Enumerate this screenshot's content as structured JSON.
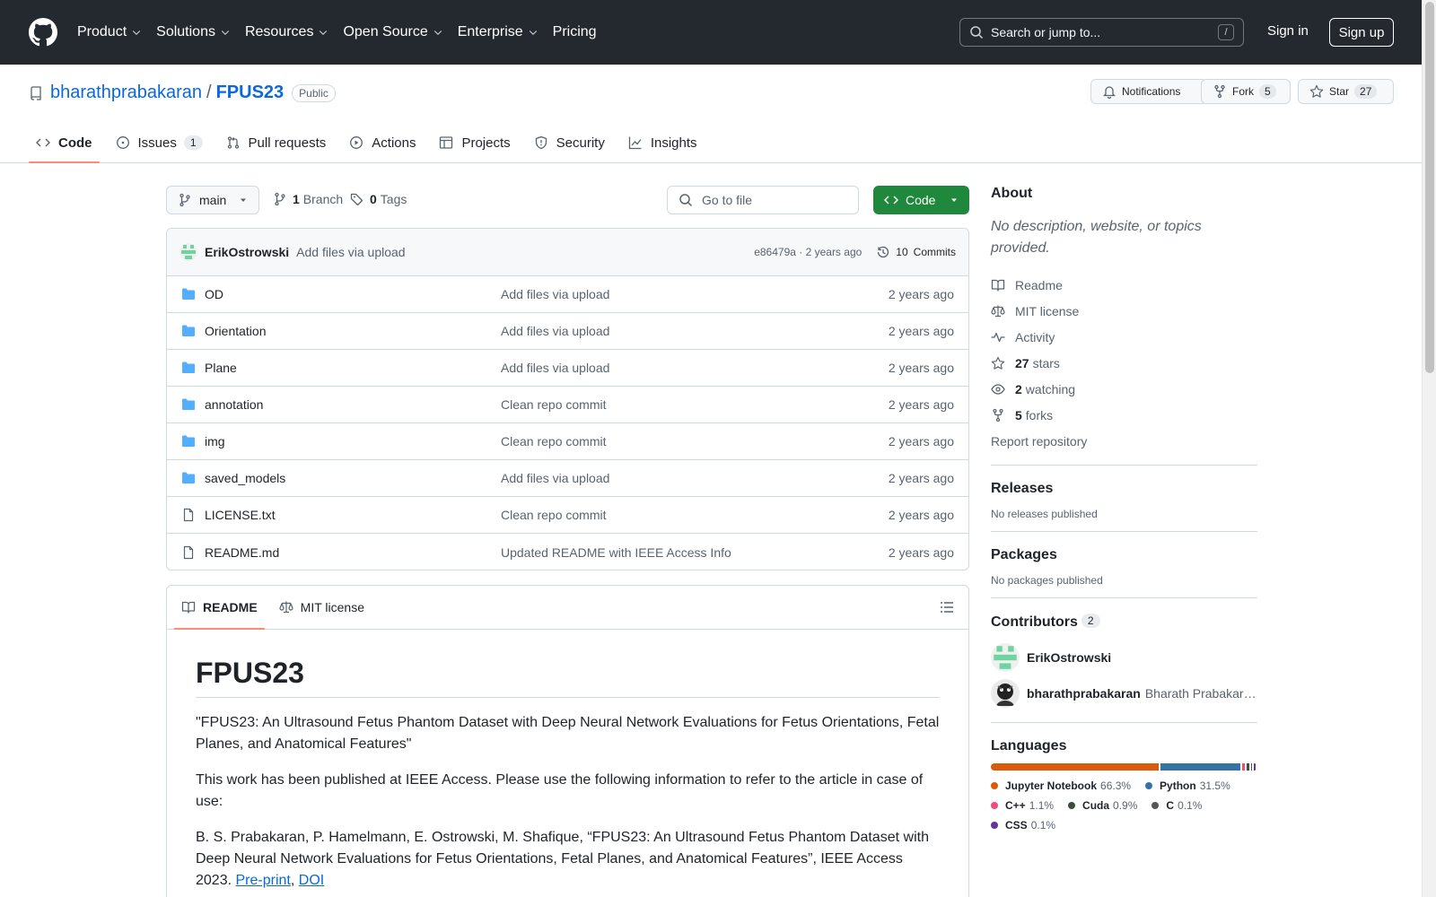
{
  "header": {
    "nav": [
      "Product",
      "Solutions",
      "Resources",
      "Open Source",
      "Enterprise",
      "Pricing"
    ],
    "search_placeholder": "Search or jump to...",
    "search_shortcut": "/",
    "sign_in": "Sign in",
    "sign_up": "Sign up"
  },
  "repo": {
    "owner": "bharathprabakaran",
    "separator": "/",
    "name": "FPUS23",
    "visibility": "Public",
    "notifications_label": "Notifications",
    "fork_label": "Fork",
    "fork_count": "5",
    "star_label": "Star",
    "star_count": "27",
    "tabs": [
      {
        "label": "Code",
        "count": ""
      },
      {
        "label": "Issues",
        "count": "1"
      },
      {
        "label": "Pull requests",
        "count": ""
      },
      {
        "label": "Actions",
        "count": ""
      },
      {
        "label": "Projects",
        "count": ""
      },
      {
        "label": "Security",
        "count": ""
      },
      {
        "label": "Insights",
        "count": ""
      }
    ]
  },
  "toolbar": {
    "branch": "main",
    "branch_count": "1",
    "branch_label": "Branch",
    "tag_count": "0",
    "tag_label": "Tags",
    "goto_placeholder": "Go to file",
    "code_label": "Code"
  },
  "commit": {
    "author": "ErikOstrowski",
    "message": "Add files via upload",
    "hash_time": "e86479a · 2 years ago",
    "commits_count": "10",
    "commits_label": "Commits"
  },
  "files": [
    {
      "name": "OD",
      "type": "folder",
      "message": "Add files via upload",
      "age": "2 years ago"
    },
    {
      "name": "Orientation",
      "type": "folder",
      "message": "Add files via upload",
      "age": "2 years ago"
    },
    {
      "name": "Plane",
      "type": "folder",
      "message": "Add files via upload",
      "age": "2 years ago"
    },
    {
      "name": "annotation",
      "type": "folder",
      "message": "Clean repo commit",
      "age": "2 years ago"
    },
    {
      "name": "img",
      "type": "folder",
      "message": "Clean repo commit",
      "age": "2 years ago"
    },
    {
      "name": "saved_models",
      "type": "folder",
      "message": "Add files via upload",
      "age": "2 years ago"
    },
    {
      "name": "LICENSE.txt",
      "type": "file",
      "message": "Clean repo commit",
      "age": "2 years ago"
    },
    {
      "name": "README.md",
      "type": "file",
      "message": "Updated README with IEEE Access Info",
      "age": "2 years ago"
    }
  ],
  "readme": {
    "tab_readme": "README",
    "tab_license": "MIT license",
    "title": "FPUS23",
    "p1": "\"FPUS23: An Ultrasound Fetus Phantom Dataset with Deep Neural Network Evaluations for Fetus Orientations, Fetal Planes, and Anatomical Features\"",
    "p2": "This work has been published at IEEE Access. Please use the following information to refer to the article in case of use:",
    "p3": "B. S. Prabakaran, P. Hamelmann, E. Ostrowski, M. Shafique, “FPUS23: An Ultrasound Fetus Phantom Dataset with Deep Neural Network Evaluations for Fetus Orientations, Fetal Planes, and Anatomical Features”, IEEE Access 2023.",
    "link_preprint": "Pre-print",
    "link_comma": ",",
    "link_doi": "DOI"
  },
  "sidebar": {
    "about_title": "About",
    "description": "No description, website, or topics provided.",
    "readme": "Readme",
    "license": "MIT license",
    "activity": "Activity",
    "stars_count": "27",
    "stars_label": "stars",
    "watching_count": "2",
    "watching_label": "watching",
    "forks_count": "5",
    "forks_label": "forks",
    "report": "Report repository",
    "releases_title": "Releases",
    "releases_empty": "No releases published",
    "packages_title": "Packages",
    "packages_empty": "No packages published",
    "contributors_title": "Contributors",
    "contributors_count": "2",
    "contributors": [
      {
        "login": "ErikOstrowski",
        "name": ""
      },
      {
        "login": "bharathprabakaran",
        "name": "Bharath Prabakaran"
      }
    ],
    "languages_title": "Languages",
    "languages": [
      {
        "name": "Jupyter Notebook",
        "percent": "66.3%",
        "value": 66.3,
        "color": "#DA5B0B"
      },
      {
        "name": "Python",
        "percent": "31.5%",
        "value": 31.5,
        "color": "#3572A5"
      },
      {
        "name": "C++",
        "percent": "1.1%",
        "value": 1.1,
        "color": "#f34b7d"
      },
      {
        "name": "Cuda",
        "percent": "0.9%",
        "value": 0.9,
        "color": "#3A4E3A"
      },
      {
        "name": "C",
        "percent": "0.1%",
        "value": 0.1,
        "color": "#555555"
      },
      {
        "name": "CSS",
        "percent": "0.1%",
        "value": 0.1,
        "color": "#663399"
      }
    ]
  }
}
